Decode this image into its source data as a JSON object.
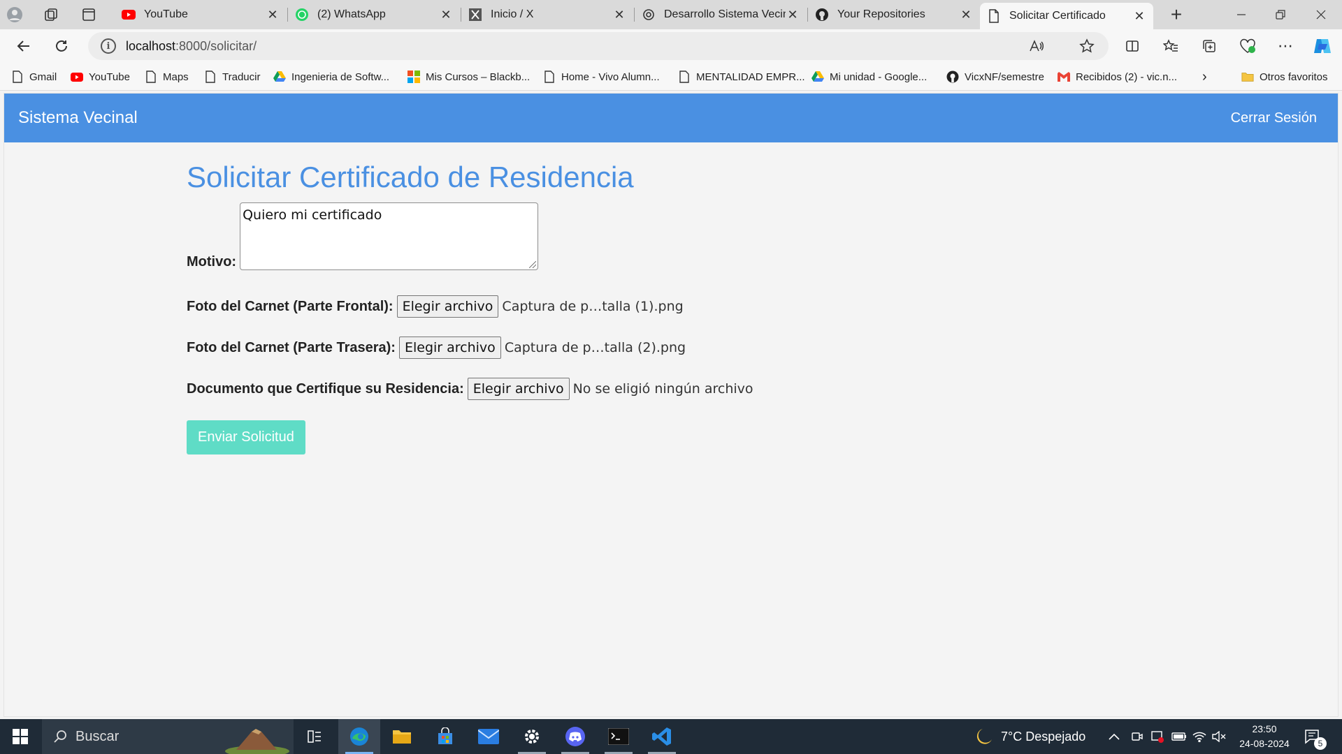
{
  "browser": {
    "tabs": [
      {
        "title": "YouTube",
        "icon": "youtube-icon"
      },
      {
        "title": "(2) WhatsApp",
        "icon": "whatsapp-icon"
      },
      {
        "title": "Inicio / X",
        "icon": "x-icon"
      },
      {
        "title": "Desarrollo Sistema Vecina",
        "icon": "chatgpt-icon"
      },
      {
        "title": "Your Repositories",
        "icon": "github-icon"
      },
      {
        "title": "Solicitar Certificado",
        "icon": "page-icon"
      }
    ],
    "active_tab": 5,
    "url_host": "localhost",
    "url_path": ":8000/solicitar/",
    "bookmarks": [
      {
        "label": "Gmail",
        "icon": "page-icon"
      },
      {
        "label": "YouTube",
        "icon": "youtube-icon"
      },
      {
        "label": "Maps",
        "icon": "page-icon"
      },
      {
        "label": "Traducir",
        "icon": "page-icon"
      },
      {
        "label": "Ingenieria de Softw...",
        "icon": "drive-icon"
      },
      {
        "label": "Mis Cursos – Blackb...",
        "icon": "microsoft-icon"
      },
      {
        "label": "Home - Vivo Alumn...",
        "icon": "page-icon"
      },
      {
        "label": "MENTALIDAD EMPR...",
        "icon": "page-icon"
      },
      {
        "label": "Mi unidad - Google...",
        "icon": "drive-icon"
      },
      {
        "label": "VicxNF/semestre",
        "icon": "github-icon"
      },
      {
        "label": "Recibidos (2) - vic.n...",
        "icon": "gmail-icon"
      }
    ],
    "other_favorites": "Otros favoritos"
  },
  "app": {
    "brand": "Sistema Vecinal",
    "logout": "Cerrar Sesión",
    "page_title": "Solicitar Certificado de Residencia",
    "motivo_label": "Motivo:",
    "motivo_value": "Quiero mi certificado",
    "front_label": "Foto del Carnet (Parte Frontal):",
    "front_file": "Captura de p…talla (1).png",
    "back_label": "Foto del Carnet (Parte Trasera):",
    "back_file": "Captura de p…talla (2).png",
    "doc_label": "Documento que Certifique su Residencia:",
    "doc_file": "No se eligió ningún archivo",
    "choose_file": "Elegir archivo",
    "submit": "Enviar Solicitud"
  },
  "taskbar": {
    "search_placeholder": "Buscar",
    "weather": "7°C  Despejado",
    "time": "23:50",
    "date": "24-08-2024",
    "notifications": "5"
  },
  "colors": {
    "header_blue": "#4a90e2",
    "submit_teal": "#5fdcc6"
  }
}
